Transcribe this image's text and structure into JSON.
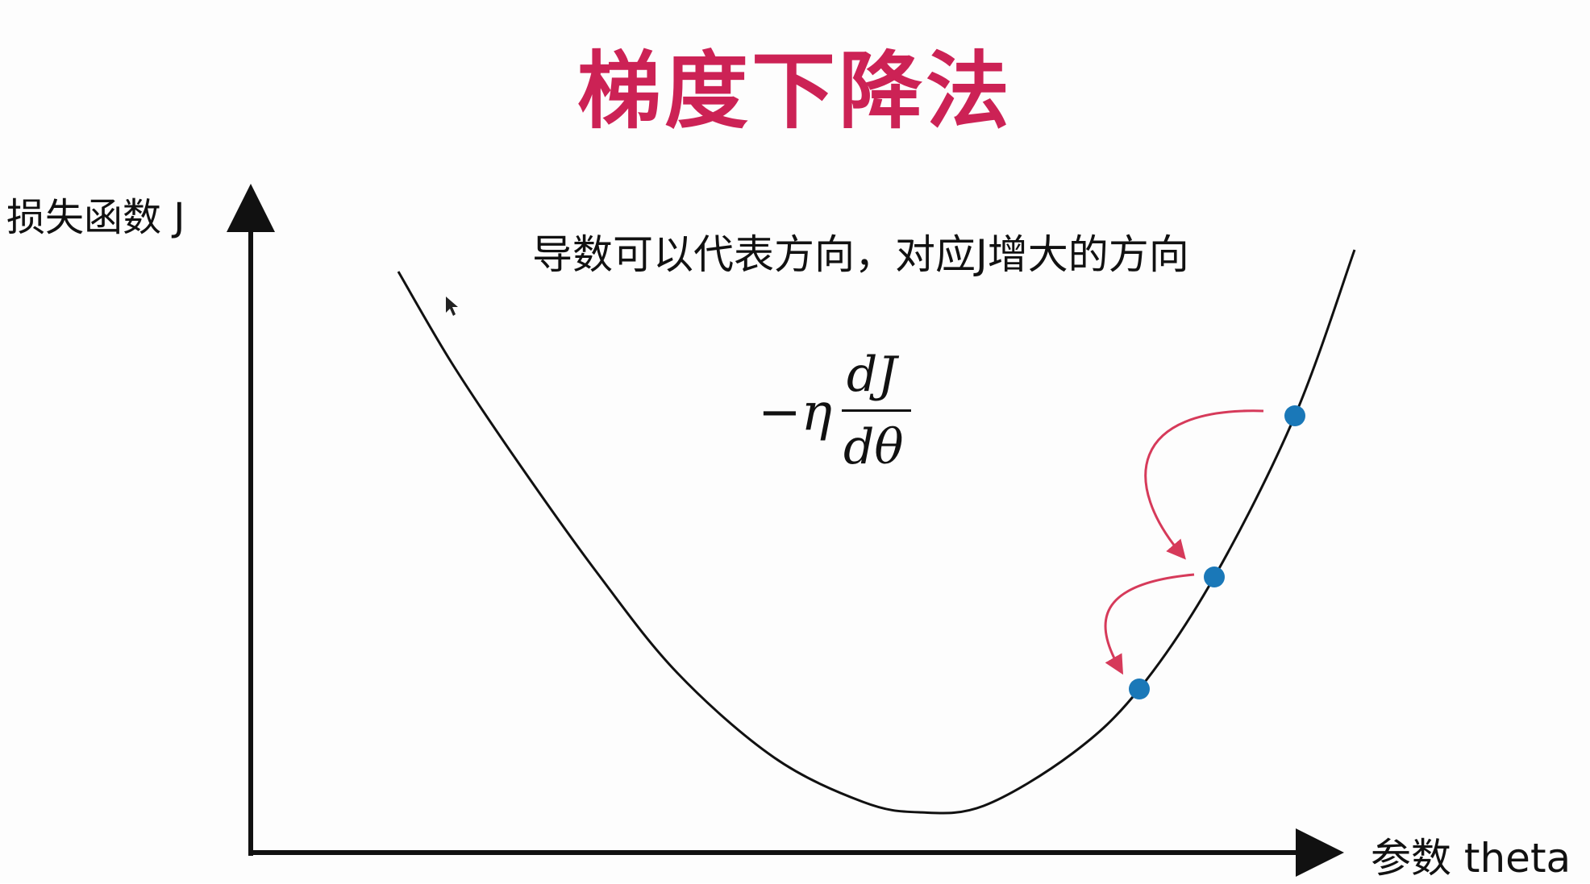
{
  "title": "梯度下降法",
  "axes": {
    "y_label": "损失函数 J",
    "x_label": "参数 theta"
  },
  "annotation": "导数可以代表方向，对应J增大的方向",
  "formula": {
    "prefix": "−η",
    "numerator": "dJ",
    "denominator": "dθ"
  },
  "colors": {
    "title": "#cc2255",
    "point": "#1a78b8",
    "arrow": "#d63a5a",
    "curve": "#111111"
  },
  "points_count_note": ""
}
